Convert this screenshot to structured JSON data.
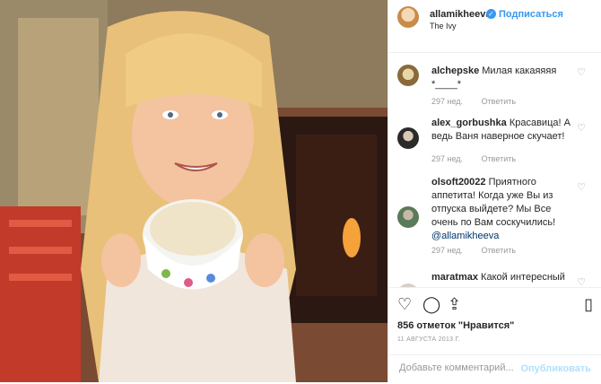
{
  "header": {
    "username": "allamikheeva",
    "follow_label": "Подписаться",
    "location": "The Ivy"
  },
  "comments": [
    {
      "user": "alchepske",
      "text": "Милая какаяяяя *____*",
      "age": "297 нед.",
      "reply": "Ответить"
    },
    {
      "user": "alex_gorbushka",
      "text": "Красавица! А ведь Ваня наверное скучает!",
      "age": "297 нед.",
      "reply": "Ответить"
    },
    {
      "user": "olsoft20022",
      "text": "Приятного аппетита! Когда уже Вы из отпуска выйдете? Мы Все очень по Вам соскучились!",
      "mention": "@allamikheeva",
      "age": "297 нед.",
      "reply": "Ответить"
    },
    {
      "user": "maratmax",
      "text": "Какой интересный"
    }
  ],
  "actions": {
    "likes": "856 отметок \"Нравится\"",
    "date": "11 АВГУСТА 2013 Г."
  },
  "add_comment": {
    "placeholder": "Добавьте комментарий...",
    "post_label": "Опубликовать"
  },
  "colors": {
    "link": "#3897f0",
    "text": "#262626",
    "muted": "#999999"
  }
}
